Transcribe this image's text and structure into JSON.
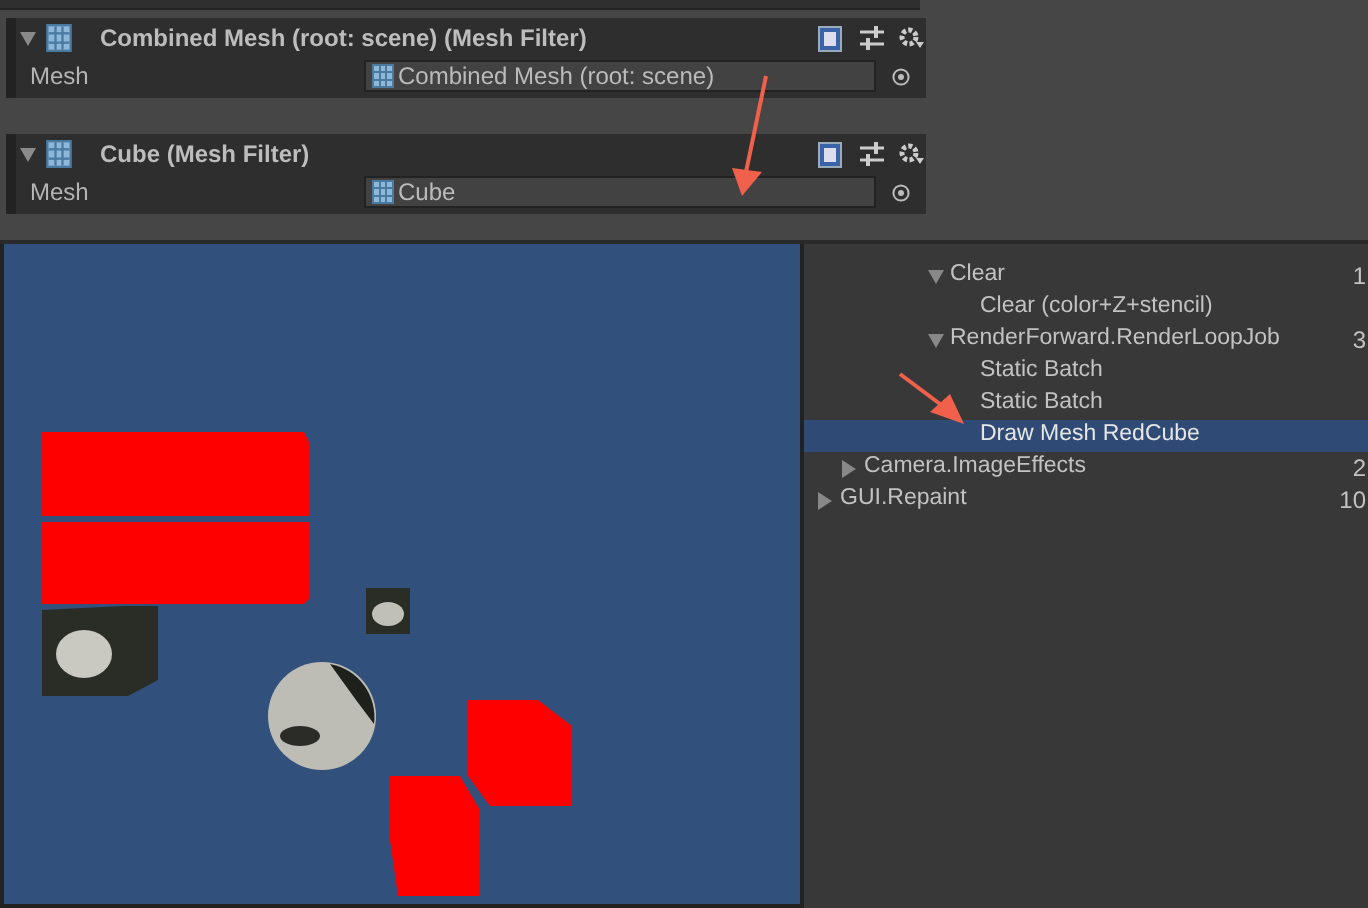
{
  "inspector_components": [
    {
      "title": "Combined Mesh (root: scene) (Mesh Filter)",
      "expanded": true,
      "property_label": "Mesh",
      "property_value": "Combined Mesh (root: scene)"
    },
    {
      "title": "Cube (Mesh Filter)",
      "expanded": true,
      "property_label": "Mesh",
      "property_value": "Cube"
    }
  ],
  "frame_debugger": {
    "rows": [
      {
        "children": [
          {
            "children": [
              {
                "label": "Clear",
                "expanded": true,
                "count": "1",
                "selected": false,
                "children": [
                  {
                    "label": "Clear (color+Z+stencil)",
                    "selected": false
                  }
                ]
              },
              {
                "label": "RenderForward.RenderLoopJob",
                "expanded": true,
                "count": "3",
                "selected": false,
                "children": [
                  {
                    "label": "Static Batch",
                    "selected": false
                  },
                  {
                    "label": "Static Batch",
                    "selected": false
                  },
                  {
                    "label": "Draw Mesh RedCube",
                    "selected": true
                  }
                ]
              }
            ]
          },
          {
            "label": "Camera.ImageEffects",
            "expanded": false,
            "count": "2",
            "selected": false
          }
        ]
      },
      {
        "label": "GUI.Repaint",
        "expanded": false,
        "count": "10",
        "selected": false
      }
    ]
  }
}
